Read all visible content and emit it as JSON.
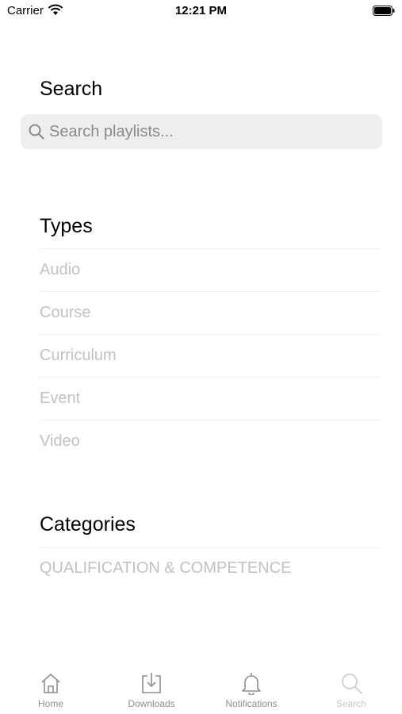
{
  "status_bar": {
    "carrier": "Carrier",
    "time": "12:21 PM"
  },
  "search": {
    "title": "Search",
    "placeholder": "Search playlists...",
    "value": ""
  },
  "types": {
    "title": "Types",
    "items": [
      {
        "label": "Audio"
      },
      {
        "label": "Course"
      },
      {
        "label": "Curriculum"
      },
      {
        "label": "Event"
      },
      {
        "label": "Video"
      }
    ]
  },
  "categories": {
    "title": "Categories",
    "items": [
      {
        "label": "QUALIFICATION & COMPETENCE"
      }
    ]
  },
  "tab_bar": {
    "tabs": [
      {
        "label": "Home",
        "icon": "home-icon"
      },
      {
        "label": "Downloads",
        "icon": "download-icon"
      },
      {
        "label": "Notifications",
        "icon": "bell-icon"
      },
      {
        "label": "Search",
        "icon": "magnifier-icon"
      }
    ],
    "selected": "Search"
  },
  "colors": {
    "inactive_list_text": "#c2c2c2",
    "search_field_bg": "#eeeeef",
    "tab_label": "#8e8e93"
  }
}
